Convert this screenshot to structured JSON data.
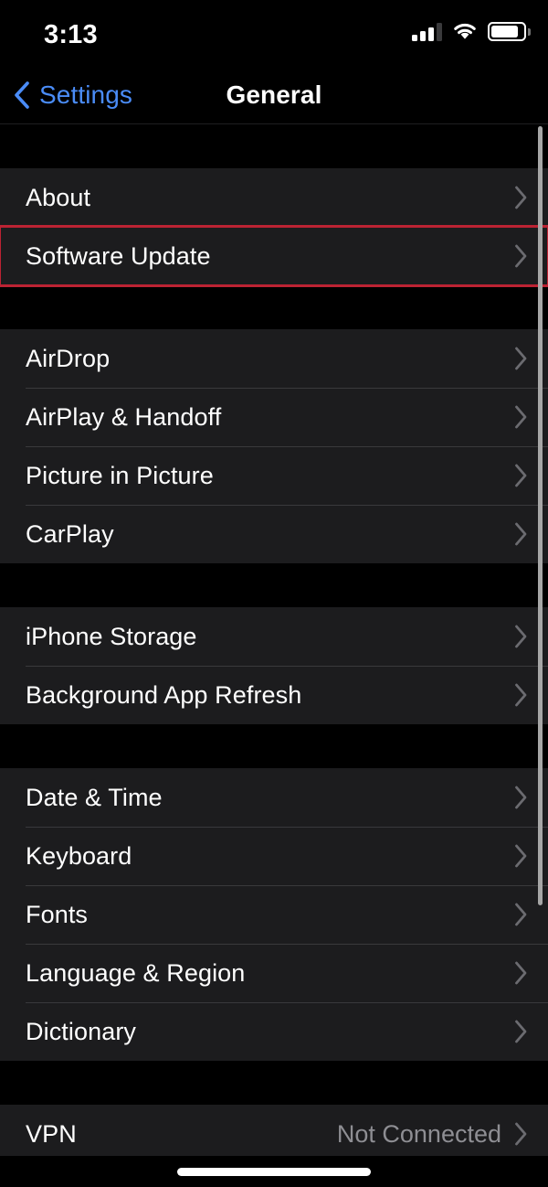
{
  "status_bar": {
    "time": "3:13",
    "cellular_icon": "cellular-signal-icon",
    "cellular_bars_filled": 3,
    "cellular_bars_total": 4,
    "wifi_icon": "wifi-icon",
    "battery_icon": "battery-icon",
    "battery_level_percent": 85
  },
  "nav_bar": {
    "back_label": "Settings",
    "back_icon": "chevron-left-icon",
    "title": "General",
    "accent_color": "#4a8cf7"
  },
  "colors": {
    "background": "#000000",
    "row_background": "#1c1c1e",
    "separator": "#39393c",
    "primary_text": "#ffffff",
    "secondary_text": "#8e8e93",
    "accent": "#4a8cf7",
    "highlight_border": "#bc2333",
    "scrollbar": "#a6a6a6"
  },
  "groups": [
    {
      "name": "about-group",
      "rows": [
        {
          "label": "About",
          "value": "",
          "accessory": "chevron-right-icon",
          "highlighted": false
        },
        {
          "label": "Software Update",
          "value": "",
          "accessory": "chevron-right-icon",
          "highlighted": true
        }
      ]
    },
    {
      "name": "connectivity-group",
      "rows": [
        {
          "label": "AirDrop",
          "value": "",
          "accessory": "chevron-right-icon",
          "highlighted": false
        },
        {
          "label": "AirPlay & Handoff",
          "value": "",
          "accessory": "chevron-right-icon",
          "highlighted": false
        },
        {
          "label": "Picture in Picture",
          "value": "",
          "accessory": "chevron-right-icon",
          "highlighted": false
        },
        {
          "label": "CarPlay",
          "value": "",
          "accessory": "chevron-right-icon",
          "highlighted": false
        }
      ]
    },
    {
      "name": "storage-group",
      "rows": [
        {
          "label": "iPhone Storage",
          "value": "",
          "accessory": "chevron-right-icon",
          "highlighted": false
        },
        {
          "label": "Background App Refresh",
          "value": "",
          "accessory": "chevron-right-icon",
          "highlighted": false
        }
      ]
    },
    {
      "name": "localization-group",
      "rows": [
        {
          "label": "Date & Time",
          "value": "",
          "accessory": "chevron-right-icon",
          "highlighted": false
        },
        {
          "label": "Keyboard",
          "value": "",
          "accessory": "chevron-right-icon",
          "highlighted": false
        },
        {
          "label": "Fonts",
          "value": "",
          "accessory": "chevron-right-icon",
          "highlighted": false
        },
        {
          "label": "Language & Region",
          "value": "",
          "accessory": "chevron-right-icon",
          "highlighted": false
        },
        {
          "label": "Dictionary",
          "value": "",
          "accessory": "chevron-right-icon",
          "highlighted": false
        }
      ]
    },
    {
      "name": "vpn-group",
      "rows": [
        {
          "label": "VPN",
          "value": "Not Connected",
          "accessory": "chevron-right-icon",
          "highlighted": false
        }
      ]
    }
  ],
  "scrollbar": {
    "name": "vertical-scrollbar"
  },
  "home_indicator": {
    "name": "home-indicator"
  }
}
